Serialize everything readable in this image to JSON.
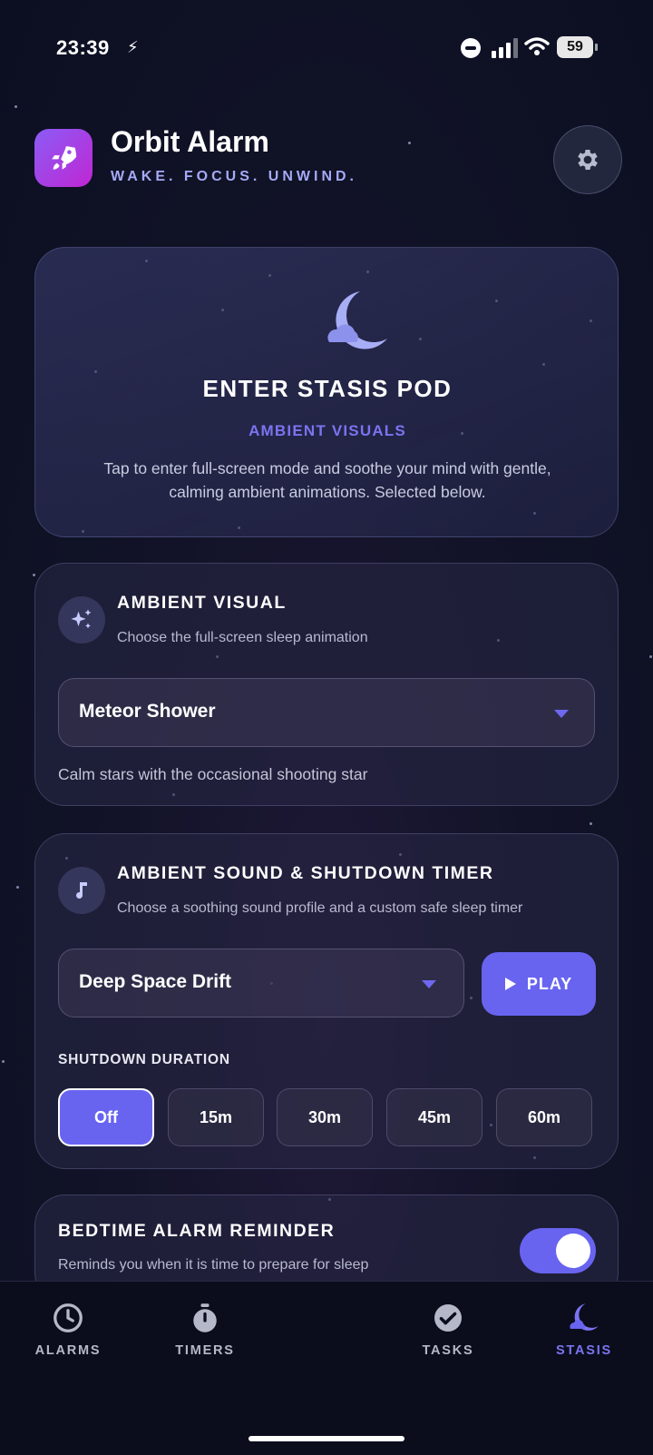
{
  "status_bar": {
    "time": "23:39",
    "battery": "59",
    "icons": [
      "bolt-icon",
      "do-not-disturb-icon",
      "signal-icon",
      "wifi-icon",
      "battery-icon"
    ]
  },
  "header": {
    "title": "Orbit Alarm",
    "tagline": "WAKE. FOCUS. UNWIND.",
    "logo_icon": "rocket-icon",
    "settings_icon": "gear-icon"
  },
  "stasis_card": {
    "icon": "moon-cloud-icon",
    "title": "ENTER STASIS POD",
    "subtitle": "AMBIENT VISUALS",
    "description": "Tap to enter full-screen mode and soothe your mind with gentle, calming ambient animations. Selected below."
  },
  "ambient_visual": {
    "icon": "sparkles-icon",
    "title": "AMBIENT VISUAL",
    "description": "Choose the full-screen sleep animation",
    "selected": "Meteor Shower",
    "caption": "Calm stars with the occasional shooting star"
  },
  "ambient_sound": {
    "icon": "music-note-icon",
    "title": "AMBIENT SOUND & SHUTDOWN TIMER",
    "description": "Choose a soothing sound profile and a custom safe sleep timer",
    "selected": "Deep Space Drift",
    "play_label": "PLAY",
    "duration_label": "SHUTDOWN DURATION",
    "durations": [
      "Off",
      "15m",
      "30m",
      "45m",
      "60m"
    ],
    "active_duration": "Off"
  },
  "bedtime": {
    "title": "BEDTIME ALARM REMINDER",
    "description": "Reminds you when it is time to prepare for sleep",
    "enabled": true
  },
  "nav": {
    "items": [
      {
        "label": "ALARMS",
        "icon": "clock-icon"
      },
      {
        "label": "TIMERS",
        "icon": "stopwatch-icon"
      },
      {
        "label": "TASKS",
        "icon": "check-circle-icon"
      },
      {
        "label": "STASIS",
        "icon": "moon-cloud-icon"
      }
    ],
    "active": "STASIS"
  },
  "colors": {
    "accent": "#6864f0",
    "accent_text": "#7b74f0",
    "tagline": "#a5aaf5",
    "background": "#0c0f22"
  }
}
